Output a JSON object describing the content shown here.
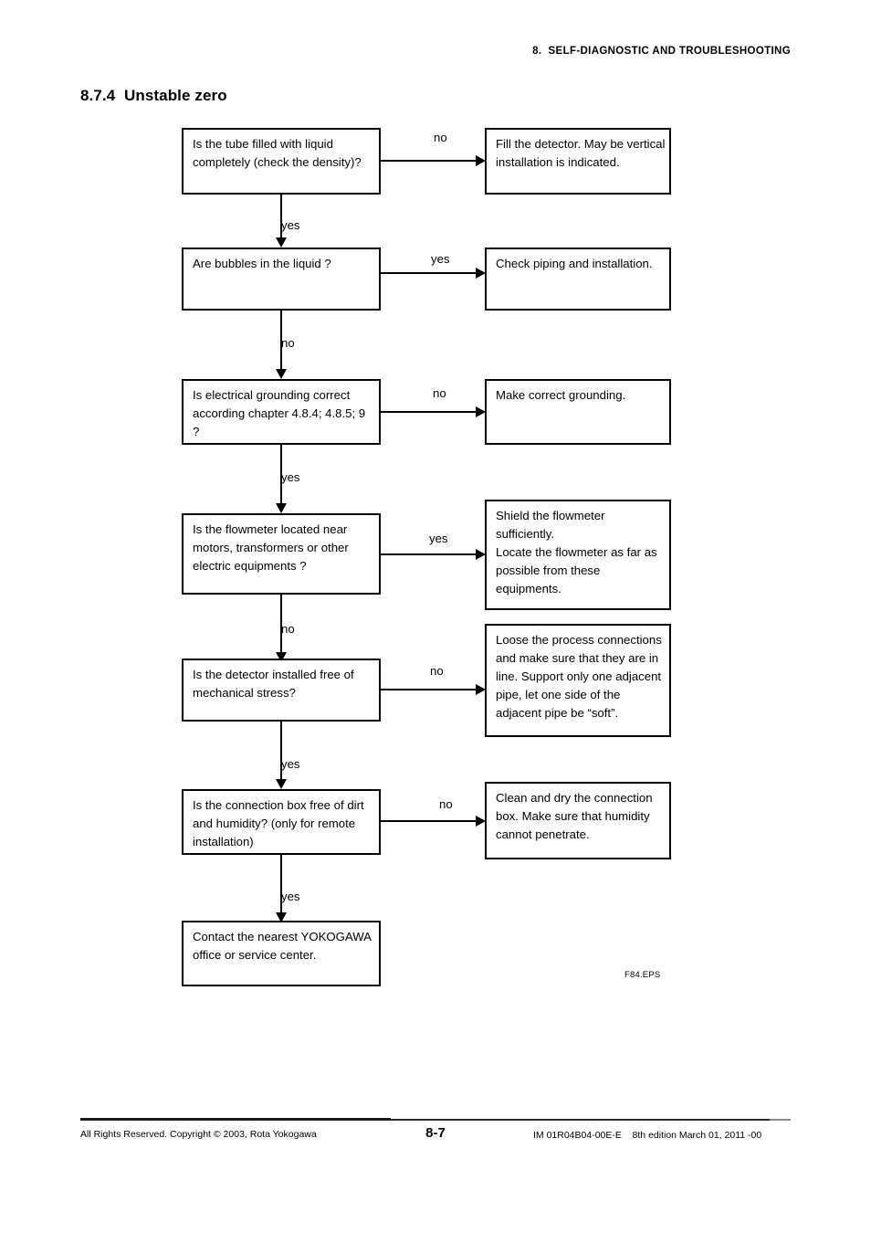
{
  "header": {
    "running_title": "8.  SELF-DIAGNOSTIC AND TROUBLESHOOTING"
  },
  "section": {
    "number": "8.7.4",
    "title": "8.7.4  Unstable zero"
  },
  "flowchart": {
    "eps_label": "F84.EPS",
    "decisions": [
      {
        "id": "tube-filled",
        "text": "Is the tube filled with liquid completely (check the density)?",
        "branch_out_label": "no",
        "continue_label": "yes"
      },
      {
        "id": "bubbles",
        "text": "Are bubbles in the liquid ?",
        "branch_out_label": "yes",
        "continue_label": "no"
      },
      {
        "id": "grounding",
        "text": "Is electrical grounding correct  according chapter 4.8.4; 4.8.5; 9    ?",
        "branch_out_label": "no",
        "continue_label": "yes"
      },
      {
        "id": "near-motors",
        "text": "Is the flowmeter located near motors, transformers or other electric equipments ?",
        "branch_out_label": "yes",
        "continue_label": "no"
      },
      {
        "id": "mechanical-stress",
        "text": "Is the detector installed free of mechanical stress?",
        "branch_out_label": "no",
        "continue_label": "yes"
      },
      {
        "id": "connection-box",
        "text": "Is the connection box free of dirt and humidity? (only for remote installation)",
        "branch_out_label": "no",
        "continue_label": "yes"
      }
    ],
    "actions": [
      {
        "id": "fill-detector",
        "text": "Fill the detector. May be vertical installation is indicated."
      },
      {
        "id": "check-piping",
        "text": "Check piping and installation."
      },
      {
        "id": "make-grounding",
        "text": "Make correct grounding."
      },
      {
        "id": "shield-flowmeter",
        "text": "Shield the flowmeter sufficiently.\nLocate the flowmeter as far as possible from these equipments."
      },
      {
        "id": "loose-connections",
        "text": "Loose the process connections and make sure that they are in line. Support only one adjacent pipe, let one side of the adjacent pipe be “soft”."
      },
      {
        "id": "clean-dry",
        "text": "Clean and dry the connection box. Make sure that humidity cannot penetrate."
      }
    ],
    "terminal": {
      "id": "contact-yokogawa",
      "text": "Contact the nearest YOKOGAWA office or service center."
    }
  },
  "footer": {
    "copyright": "All Rights Reserved. Copyright © 2003, Rota Yokogawa",
    "page_number": "8-7",
    "doc_number": "IM 01R04B04-00E-E    8th edition March 01, 2011 -00"
  },
  "colors": {
    "ink": "#000000",
    "rule": "#1a1a1a",
    "rule_light": "#8c8c8c"
  }
}
